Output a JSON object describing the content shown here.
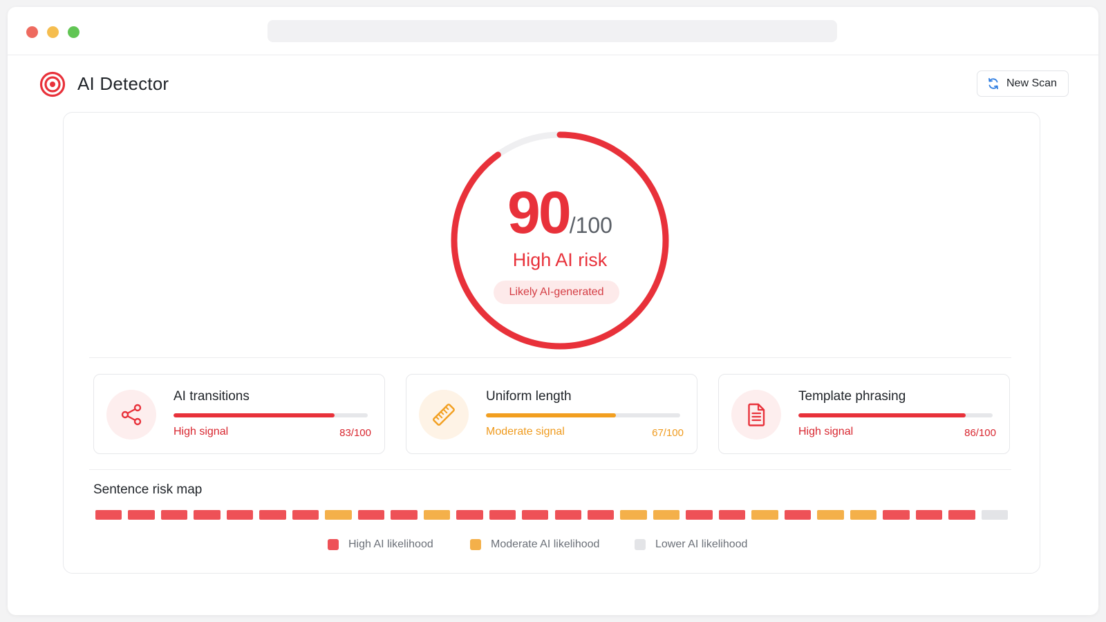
{
  "app": {
    "title": "AI Detector"
  },
  "header": {
    "new_scan_label": "New Scan"
  },
  "score": {
    "value": "90",
    "max_label": "/100",
    "fraction": 0.9,
    "risk_label": "High AI risk",
    "badge": "Likely AI-generated"
  },
  "metrics": [
    {
      "title": "AI transitions",
      "signal": "High signal",
      "score_label": "83/100",
      "value": 83,
      "level": "high",
      "icon": "share-icon"
    },
    {
      "title": "Uniform length",
      "signal": "Moderate signal",
      "score_label": "67/100",
      "value": 67,
      "level": "moderate",
      "icon": "ruler-icon"
    },
    {
      "title": "Template phrasing",
      "signal": "High signal",
      "score_label": "86/100",
      "value": 86,
      "level": "high",
      "icon": "document-icon"
    }
  ],
  "risk_map": {
    "title": "Sentence risk map",
    "segments": [
      "high",
      "high",
      "high",
      "high",
      "high",
      "high",
      "high",
      "moderate",
      "high",
      "high",
      "moderate",
      "high",
      "high",
      "high",
      "high",
      "high",
      "moderate",
      "moderate",
      "high",
      "high",
      "moderate",
      "high",
      "moderate",
      "moderate",
      "high",
      "high",
      "high",
      "lower"
    ],
    "legend": [
      {
        "label": "High AI likelihood",
        "level": "high"
      },
      {
        "label": "Moderate AI likelihood",
        "level": "moderate"
      },
      {
        "label": "Lower AI likelihood",
        "level": "lower"
      }
    ]
  },
  "colors": {
    "high": "#ee5157",
    "moderate": "#f4b04a",
    "lower": "#e3e4e7",
    "accent": "#e8313a"
  }
}
